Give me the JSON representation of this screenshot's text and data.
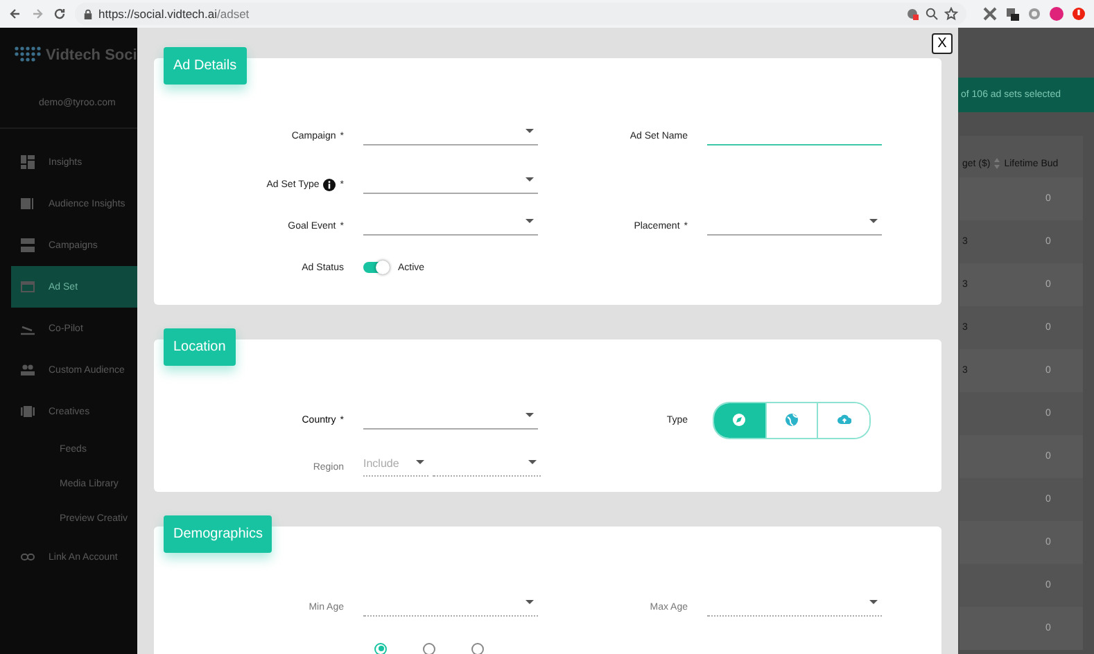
{
  "browser": {
    "url_host": "https://social.vidtech.ai",
    "url_path": "/adset"
  },
  "sidebar": {
    "brand": "Vidtech Soci",
    "email": "demo@tyroo.com",
    "items": [
      {
        "label": "Insights",
        "selected": false
      },
      {
        "label": "Audience Insights",
        "selected": false
      },
      {
        "label": "Campaigns",
        "selected": false
      },
      {
        "label": "Ad Set",
        "selected": true
      },
      {
        "label": "Co-Pilot",
        "selected": false
      },
      {
        "label": "Custom Audience",
        "selected": false
      },
      {
        "label": "Creatives",
        "selected": false,
        "children": [
          {
            "label": "Feeds",
            "selected": false
          },
          {
            "label": "Media Library",
            "selected": false
          },
          {
            "label": "Preview Creativ",
            "selected": false
          }
        ]
      },
      {
        "label": "Link An Account",
        "selected": false
      }
    ]
  },
  "background": {
    "selection_banner": "of 106 ad sets selected",
    "table": {
      "columns": [
        "get ($)",
        "Lifetime Bud"
      ],
      "rows": [
        {
          "column_2": "0"
        },
        {
          "column_1": "3",
          "column_2": "0"
        },
        {
          "column_1": "3",
          "column_2": "0"
        },
        {
          "column_1": "3",
          "column_2": "0"
        },
        {
          "column_1": "3",
          "column_2": "0"
        },
        {
          "column_2": "0"
        },
        {
          "column_2": "0"
        },
        {
          "column_2": "0"
        },
        {
          "column_2": "0"
        },
        {
          "column_2": "0"
        },
        {
          "column_2": "0"
        }
      ]
    }
  },
  "modal": {
    "close": "X",
    "sections": [
      {
        "title": "Ad Details",
        "rows": [
          [
            {
              "kind": "select",
              "label": "Campaign",
              "required_mark": "*",
              "disabled": false
            },
            {
              "kind": "text",
              "label": "Ad Set Name",
              "focused": true
            }
          ],
          [
            {
              "kind": "select",
              "label": "Ad Set Type",
              "required_mark": "*",
              "info": true,
              "disabled": false
            }
          ],
          [
            {
              "kind": "select",
              "label": "Goal Event",
              "required_mark": "*",
              "disabled": false
            },
            {
              "kind": "select",
              "label": "Placement",
              "required_mark": "*",
              "disabled": false
            }
          ],
          [
            {
              "kind": "switch",
              "label": "Ad Status",
              "on": true,
              "text": "Active"
            }
          ]
        ]
      },
      {
        "title": "Location",
        "rows": [
          [
            {
              "kind": "select",
              "label": "Country",
              "required_mark": "*",
              "disabled": false
            },
            {
              "kind": "segmented",
              "label": "Type",
              "options": [
                {
                  "selected": true
                },
                {
                  "selected": false
                },
                {
                  "selected": false
                }
              ]
            }
          ],
          [
            {
              "kind": "region",
              "label": "Region",
              "mode": "Include",
              "disabled": true
            }
          ]
        ]
      },
      {
        "title": "Demographics",
        "rows": [
          [
            {
              "kind": "select",
              "label": "Min Age",
              "disabled": true
            },
            {
              "kind": "select",
              "label": "Max Age",
              "disabled": true
            }
          ],
          [
            {
              "kind": "radio",
              "options": [
                {
                  "selected": true
                },
                {
                  "selected": false
                },
                {
                  "selected": false
                }
              ]
            }
          ]
        ]
      }
    ]
  }
}
